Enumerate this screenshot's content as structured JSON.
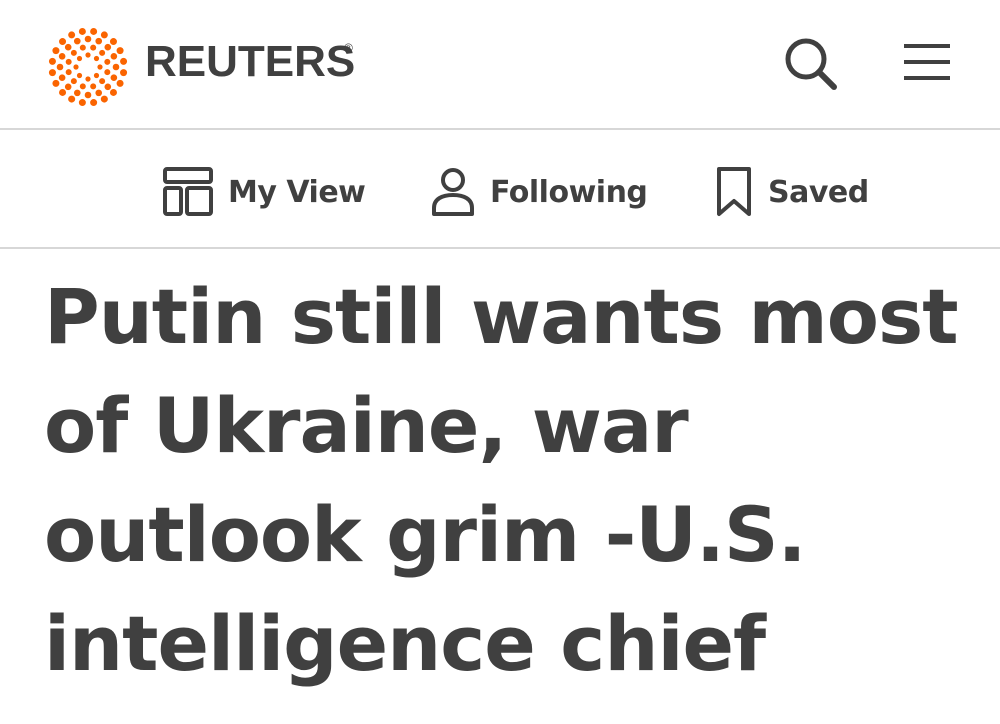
{
  "header": {
    "brand": "REUTERS",
    "registered_mark": "®",
    "brand_color": "#fa6400",
    "search_icon": "search-icon",
    "menu_icon": "hamburger-menu-icon"
  },
  "subnav": {
    "items": [
      {
        "label": "My View",
        "icon": "layout-grid-icon"
      },
      {
        "label": "Following",
        "icon": "person-icon"
      },
      {
        "label": "Saved",
        "icon": "bookmark-icon"
      }
    ]
  },
  "article": {
    "headline_lines": [
      "Putin still wants most",
      "of Ukraine, war",
      "outlook grim -U.S.",
      "intelligence chief"
    ]
  }
}
